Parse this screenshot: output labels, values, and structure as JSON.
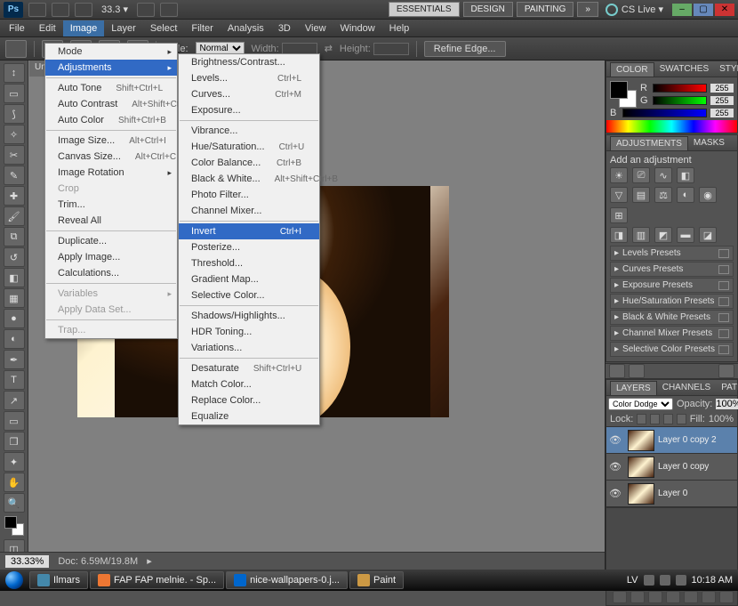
{
  "appbar": {
    "zoom": "33.3 ▾",
    "workspaces": [
      "ESSENTIALS",
      "DESIGN",
      "PAINTING"
    ],
    "more": "»",
    "cslive": "CS Live ▾"
  },
  "menubar": [
    "File",
    "Edit",
    "Image",
    "Layer",
    "Select",
    "Filter",
    "Analysis",
    "3D",
    "View",
    "Window",
    "Help"
  ],
  "optbar": {
    "style_lbl": "Style:",
    "style": "Normal",
    "width": "Width:",
    "height": "Height:",
    "refine": "Refine Edge..."
  },
  "doc_tab": "Untitl",
  "image_menu": [
    {
      "t": "Mode",
      "sub": true
    },
    {
      "t": "Adjustments",
      "sub": true,
      "hi": true
    },
    {
      "sep": true
    },
    {
      "t": "Auto Tone",
      "sc": "Shift+Ctrl+L"
    },
    {
      "t": "Auto Contrast",
      "sc": "Alt+Shift+Ctrl+L"
    },
    {
      "t": "Auto Color",
      "sc": "Shift+Ctrl+B"
    },
    {
      "sep": true
    },
    {
      "t": "Image Size...",
      "sc": "Alt+Ctrl+I"
    },
    {
      "t": "Canvas Size...",
      "sc": "Alt+Ctrl+C"
    },
    {
      "t": "Image Rotation",
      "sub": true
    },
    {
      "t": "Crop",
      "dis": true
    },
    {
      "t": "Trim..."
    },
    {
      "t": "Reveal All"
    },
    {
      "sep": true
    },
    {
      "t": "Duplicate..."
    },
    {
      "t": "Apply Image..."
    },
    {
      "t": "Calculations..."
    },
    {
      "sep": true
    },
    {
      "t": "Variables",
      "sub": true,
      "dis": true
    },
    {
      "t": "Apply Data Set...",
      "dis": true
    },
    {
      "sep": true
    },
    {
      "t": "Trap...",
      "dis": true
    }
  ],
  "adj_menu": [
    {
      "t": "Brightness/Contrast..."
    },
    {
      "t": "Levels...",
      "sc": "Ctrl+L"
    },
    {
      "t": "Curves...",
      "sc": "Ctrl+M"
    },
    {
      "t": "Exposure..."
    },
    {
      "sep": true
    },
    {
      "t": "Vibrance..."
    },
    {
      "t": "Hue/Saturation...",
      "sc": "Ctrl+U"
    },
    {
      "t": "Color Balance...",
      "sc": "Ctrl+B"
    },
    {
      "t": "Black & White...",
      "sc": "Alt+Shift+Ctrl+B"
    },
    {
      "t": "Photo Filter..."
    },
    {
      "t": "Channel Mixer..."
    },
    {
      "sep": true
    },
    {
      "t": "Invert",
      "sc": "Ctrl+I",
      "hi": true
    },
    {
      "t": "Posterize..."
    },
    {
      "t": "Threshold..."
    },
    {
      "t": "Gradient Map..."
    },
    {
      "t": "Selective Color..."
    },
    {
      "sep": true
    },
    {
      "t": "Shadows/Highlights..."
    },
    {
      "t": "HDR Toning..."
    },
    {
      "t": "Variations..."
    },
    {
      "sep": true
    },
    {
      "t": "Desaturate",
      "sc": "Shift+Ctrl+U"
    },
    {
      "t": "Match Color..."
    },
    {
      "t": "Replace Color..."
    },
    {
      "t": "Equalize"
    }
  ],
  "status": {
    "zoom": "33.33%",
    "doc": "Doc: 6.59M/19.8M"
  },
  "panels": {
    "color": {
      "tabs": [
        "COLOR",
        "SWATCHES",
        "STYLES"
      ],
      "r": "255",
      "g": "255",
      "b": "255"
    },
    "adjust": {
      "tabs": [
        "ADJUSTMENTS",
        "MASKS"
      ],
      "label": "Add an adjustment"
    },
    "presets": [
      "Levels Presets",
      "Curves Presets",
      "Exposure Presets",
      "Hue/Saturation Presets",
      "Black & White Presets",
      "Channel Mixer Presets",
      "Selective Color Presets"
    ],
    "layers": {
      "tabs": [
        "LAYERS",
        "CHANNELS",
        "PATHS"
      ],
      "blend": "Color Dodge",
      "opacity_lbl": "Opacity:",
      "opacity": "100%",
      "lock_lbl": "Lock:",
      "fill_lbl": "Fill:",
      "fill": "100%",
      "items": [
        {
          "name": "Layer 0 copy 2",
          "sel": true
        },
        {
          "name": "Layer 0 copy"
        },
        {
          "name": "Layer 0"
        }
      ]
    }
  },
  "taskbar": {
    "items": [
      {
        "label": "Ilmars"
      },
      {
        "label": "FAP FAP melnie. - Sp..."
      },
      {
        "label": "nice-wallpapers-0.j...",
        "active": true
      },
      {
        "label": "Paint"
      }
    ],
    "lang": "LV",
    "time": "10:18 AM"
  }
}
